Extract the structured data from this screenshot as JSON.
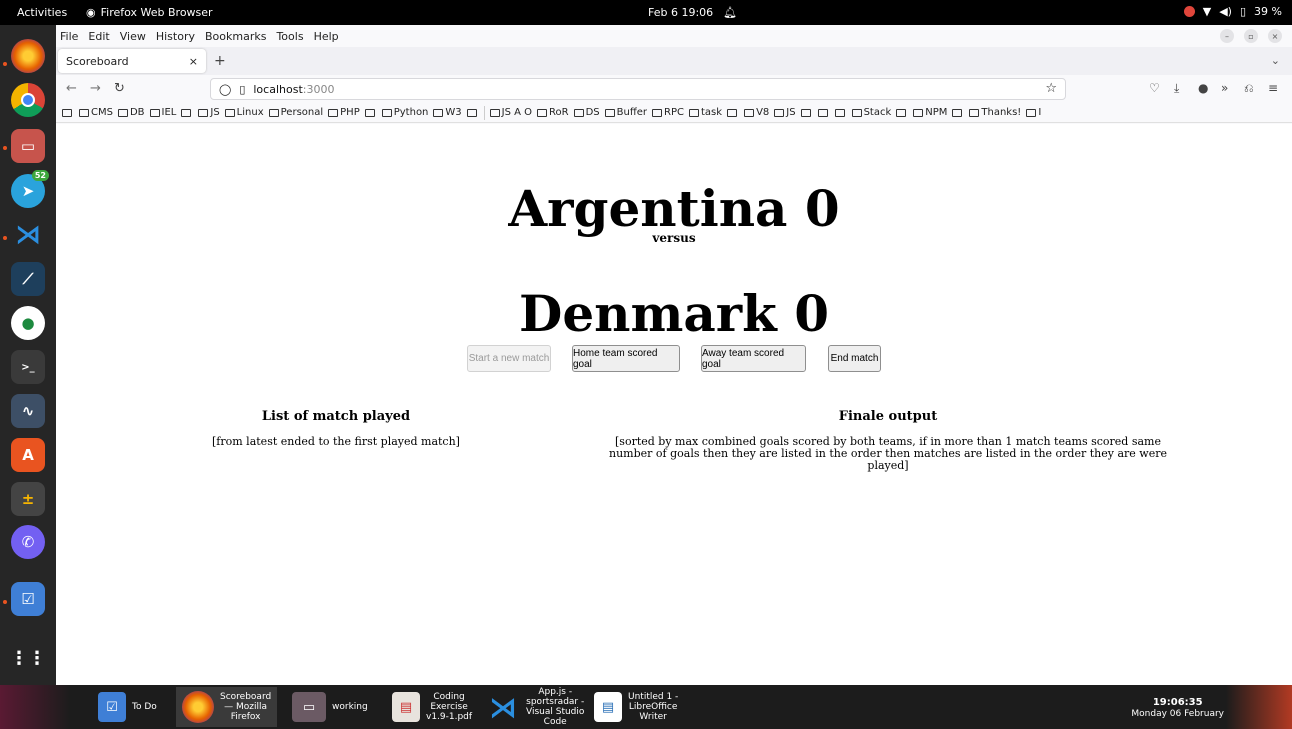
{
  "topbar": {
    "activities": "Activities",
    "app_name": "Firefox Web Browser",
    "datetime": "Feb 6  19:06",
    "battery": "39 %"
  },
  "dock": {
    "telegram_badge": "52"
  },
  "menubar": [
    "File",
    "Edit",
    "View",
    "History",
    "Bookmarks",
    "Tools",
    "Help"
  ],
  "tab": {
    "title": "Scoreboard",
    "close": "×",
    "new": "+"
  },
  "url": {
    "host": "localhost",
    "port": ":3000"
  },
  "bookmarks": [
    "",
    "CMS",
    "DB",
    "IEL",
    "",
    "JS",
    "Linux",
    "Personal",
    "PHP",
    "",
    "Python",
    "W3",
    "",
    "JS A O",
    "RoR",
    "DS",
    "Buffer",
    "RPC",
    "task",
    "",
    "V8",
    "JS",
    "",
    "",
    "",
    "Stack",
    "",
    "NPM",
    "",
    "Thanks!",
    "I"
  ],
  "scoreboard": {
    "home_line": "Argentina 0",
    "versus": "versus",
    "away_line": "Denmark 0",
    "buttons": {
      "start": "Start a new match",
      "home_goal": "Home team scored goal",
      "away_goal": "Away team scored goal",
      "end": "End match"
    },
    "list_title": "List of match played",
    "list_desc": "[from latest ended to the first played match]",
    "final_title": "Finale output",
    "final_desc_1": "[sorted by max combined goals scored by both teams, if in more than 1 match teams scored same",
    "final_desc_2": "number of goals then they are listed in the order then matches are listed in the order they are were",
    "final_desc_3": "played]"
  },
  "taskbar": {
    "todo": "To Do",
    "firefox_1": "Scoreboard",
    "firefox_2": "— Mozilla",
    "firefox_3": "Firefox",
    "working": "working",
    "pdf_1": "Coding",
    "pdf_2": "Exercise",
    "pdf_3": "v1.9-1.pdf",
    "vscode_1": "App.js -",
    "vscode_2": "sportsradar -",
    "vscode_3": "Visual Studio",
    "vscode_4": "Code",
    "writer_1": "Untitled 1 -",
    "writer_2": "LibreOffice",
    "writer_3": "Writer",
    "time": "19:06:35",
    "date": "Monday 06 February"
  }
}
